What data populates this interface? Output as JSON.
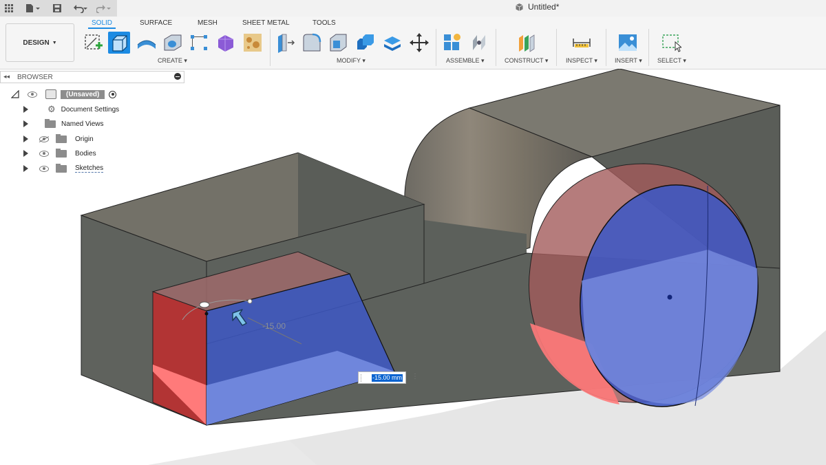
{
  "window": {
    "title": "Untitled*"
  },
  "quick_access": {
    "icons": [
      "grid-icon",
      "file-icon",
      "save-icon",
      "undo-icon",
      "redo-icon"
    ]
  },
  "workspace": {
    "label": "DESIGN"
  },
  "tabs": [
    "SOLID",
    "SURFACE",
    "MESH",
    "SHEET METAL",
    "TOOLS"
  ],
  "active_tab": "SOLID",
  "groups": {
    "create": "CREATE",
    "modify": "MODIFY",
    "assemble": "ASSEMBLE",
    "construct": "CONSTRUCT",
    "inspect": "INSPECT",
    "insert": "INSERT",
    "select": "SELECT"
  },
  "browser": {
    "title": "BROWSER",
    "root": "(Unsaved)",
    "items": [
      "Document Settings",
      "Named Views",
      "Origin",
      "Bodies",
      "Sketches"
    ]
  },
  "viewport": {
    "dimension_ghost": "-15.00",
    "dimension_input": "-15.00 mm"
  },
  "colors": {
    "accent": "#1c8be3",
    "selection_blue": "#3a55c8",
    "highlight_red": "#e03a3a"
  }
}
